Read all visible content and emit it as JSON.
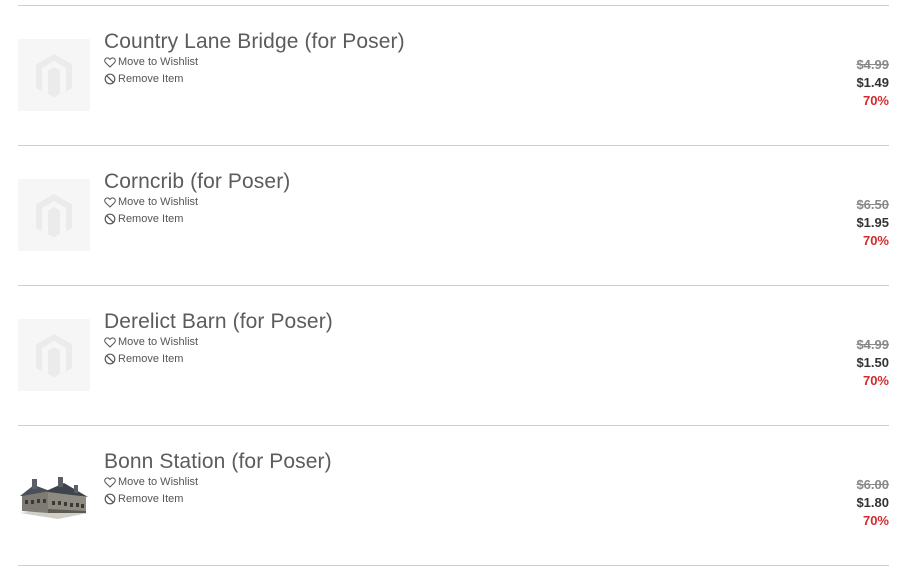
{
  "items": [
    {
      "title": "Country Lane Bridge (for Poser)",
      "wishlist_label": "Move to Wishlist",
      "remove_label": "Remove Item",
      "old_price": "$4.99",
      "price": "$1.49",
      "discount": "70%",
      "thumbnail": "placeholder-logo"
    },
    {
      "title": "Corncrib (for Poser)",
      "wishlist_label": "Move to Wishlist",
      "remove_label": "Remove Item",
      "old_price": "$6.50",
      "price": "$1.95",
      "discount": "70%",
      "thumbnail": "placeholder-logo"
    },
    {
      "title": "Derelict Barn (for Poser)",
      "wishlist_label": "Move to Wishlist",
      "remove_label": "Remove Item",
      "old_price": "$4.99",
      "price": "$1.50",
      "discount": "70%",
      "thumbnail": "placeholder-logo"
    },
    {
      "title": "Bonn Station (for Poser)",
      "wishlist_label": "Move to Wishlist",
      "remove_label": "Remove Item",
      "old_price": "$6.00",
      "price": "$1.80",
      "discount": "70%",
      "thumbnail": "station-building-image"
    }
  ],
  "colors": {
    "discount": "#d22b2b",
    "old_price": "#888888",
    "price": "#333333",
    "title": "#5c5c5c",
    "divider": "#cfcfcf",
    "thumb_bg": "#f6f6f6"
  },
  "icons": {
    "wishlist": "heart-outline-icon",
    "remove": "prohibited-icon"
  }
}
